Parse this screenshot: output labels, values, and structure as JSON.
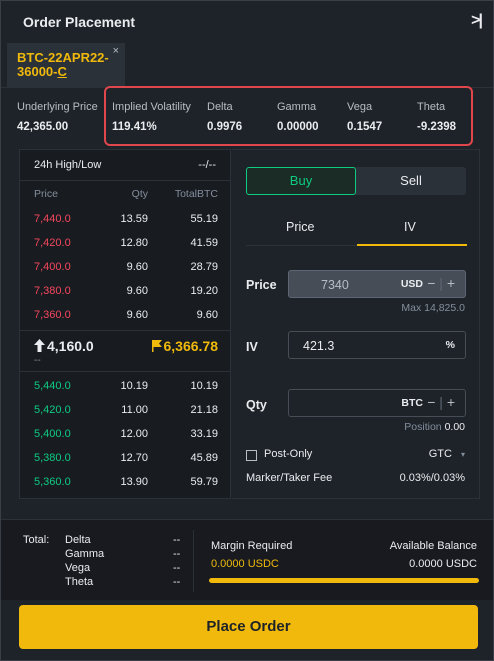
{
  "header": {
    "title": "Order Placement",
    "collapse_icon": ">|"
  },
  "tab": {
    "symbol": "BTC-22APR22-36000-",
    "symbol_suffix": "C",
    "close": "×"
  },
  "stats": [
    {
      "label": "Underlying Price",
      "value": "42,365.00"
    },
    {
      "label": "Implied Volatility",
      "value": "119.41%"
    },
    {
      "label": "Delta",
      "value": "0.9976"
    },
    {
      "label": "Gamma",
      "value": "0.00000"
    },
    {
      "label": "Vega",
      "value": "0.1547"
    },
    {
      "label": "Theta",
      "value": "-9.2398"
    }
  ],
  "orderbook": {
    "high_low_label": "24h High/Low",
    "high_low_value": "--/--",
    "columns": [
      "Price",
      "Qty",
      "TotalBTC"
    ],
    "asks": [
      [
        "7,440.0",
        "13.59",
        "55.19"
      ],
      [
        "7,420.0",
        "12.80",
        "41.59"
      ],
      [
        "7,400.0",
        "9.60",
        "28.79"
      ],
      [
        "7,380.0",
        "9.60",
        "19.20"
      ],
      [
        "7,360.0",
        "9.60",
        "9.60"
      ]
    ],
    "last_price": "4,160.0",
    "last_price_sub": "--",
    "mark_price": "6,366.78",
    "bids": [
      [
        "5,440.0",
        "10.19",
        "10.19"
      ],
      [
        "5,420.0",
        "11.00",
        "21.18"
      ],
      [
        "5,400.0",
        "12.00",
        "33.19"
      ],
      [
        "5,380.0",
        "12.70",
        "45.89"
      ],
      [
        "5,360.0",
        "13.90",
        "59.79"
      ]
    ]
  },
  "form": {
    "buy": "Buy",
    "sell": "Sell",
    "mode_tabs": [
      "Price",
      "IV"
    ],
    "active_mode": "IV",
    "price_label": "Price",
    "price_value": "7340",
    "price_unit": "USD",
    "max_hint": "Max 14,825.0",
    "iv_label": "IV",
    "iv_value": "421.3",
    "iv_unit": "%",
    "qty_label": "Qty",
    "qty_value": "",
    "qty_unit": "BTC",
    "position_label": "Position",
    "position_value": "0.00",
    "post_only": "Post-Only",
    "tif": "GTC",
    "fee_label": "Marker/Taker Fee",
    "fee_value": "0.03%/0.03%"
  },
  "summary": {
    "total_label": "Total:",
    "greeks": [
      {
        "label": "Delta",
        "value": "--"
      },
      {
        "label": "Gamma",
        "value": "--"
      },
      {
        "label": "Vega",
        "value": "--"
      },
      {
        "label": "Theta",
        "value": "--"
      }
    ],
    "margin_label": "Margin Required",
    "margin_value": "0.0000 USDC",
    "balance_label": "Available Balance",
    "balance_value": "0.0000 USDC"
  },
  "place_order": "Place Order",
  "colors": {
    "accent": "#f0b90b",
    "buy": "#0ecb81",
    "sell": "#f6465d",
    "highlight": "#e0474c"
  }
}
